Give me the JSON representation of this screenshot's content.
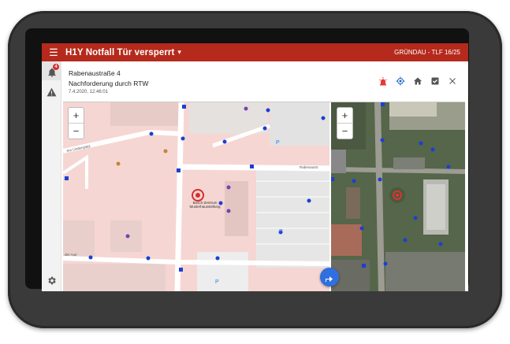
{
  "appbar": {
    "menu_icon": "hamburger-icon",
    "title": "H1Y Notfall Tür versperrt",
    "caret_icon": "chevron-down-icon",
    "unit": "GRÜNDAU - TLF 16/25"
  },
  "rail": {
    "notification_count": "4",
    "items": [
      "bell-icon",
      "warning-icon",
      "settings-icon"
    ]
  },
  "incident": {
    "address": "Rabenaustraße 4",
    "subtitle": "Nachforderung durch RTW",
    "timestamp": "7.4.2020, 12:46:01"
  },
  "actions": {
    "icons": [
      "siren-icon",
      "locate-icon",
      "home-icon",
      "checkbox-icon",
      "close-icon"
    ],
    "colors": {
      "siren": "#e53935",
      "locate": "#1565c0",
      "neutral": "#555555"
    }
  },
  "map": {
    "zoom_in": "+",
    "zoom_out": "−",
    "street_labels": [
      "Am Lindenplatz",
      "Rabenaustr.",
      "Rabenaustr",
      "Busch-Zentrum Musterhausstellung",
      "der Aue"
    ],
    "fab_icon": "directions-icon"
  },
  "colors": {
    "appbar": "#b52a1c",
    "marker": "#1a3fd6",
    "target": "#d32f2f"
  }
}
